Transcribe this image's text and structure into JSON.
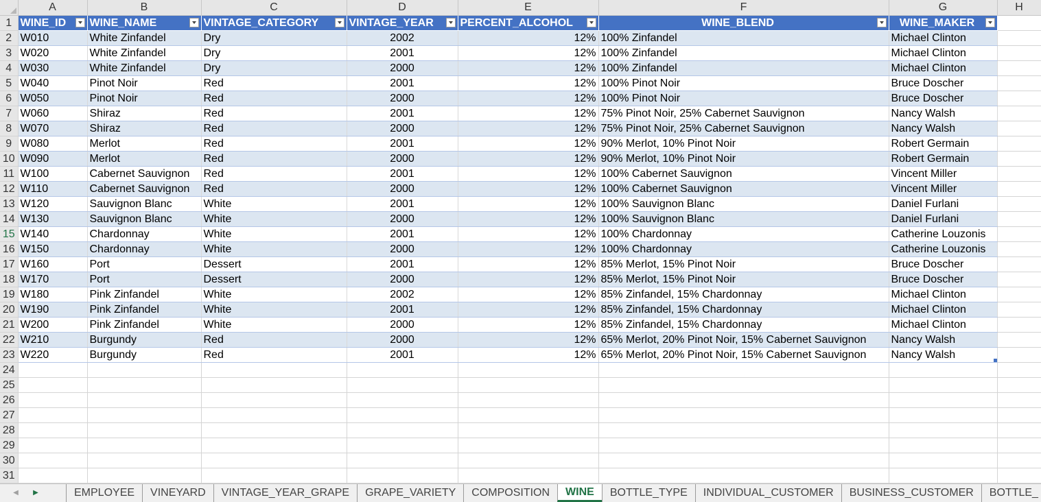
{
  "columns": [
    "A",
    "B",
    "C",
    "D",
    "E",
    "F",
    "G",
    "H"
  ],
  "headers": [
    "WINE_ID",
    "WINE_NAME",
    "VINTAGE_CATEGORY",
    "VINTAGE_YEAR",
    "PERCENT_ALCOHOL",
    "WINE_BLEND",
    "WINE_MAKER"
  ],
  "rows": [
    [
      "W010",
      "White Zinfandel",
      "Dry",
      "2002",
      "12%",
      "100% Zinfandel",
      "Michael Clinton"
    ],
    [
      "W020",
      "White Zinfandel",
      "Dry",
      "2001",
      "12%",
      "100% Zinfandel",
      "Michael Clinton"
    ],
    [
      "W030",
      "White Zinfandel",
      "Dry",
      "2000",
      "12%",
      "100% Zinfandel",
      "Michael Clinton"
    ],
    [
      "W040",
      "Pinot Noir",
      "Red",
      "2001",
      "12%",
      "100% Pinot Noir",
      "Bruce Doscher"
    ],
    [
      "W050",
      "Pinot Noir",
      "Red",
      "2000",
      "12%",
      "100% Pinot Noir",
      "Bruce Doscher"
    ],
    [
      "W060",
      "Shiraz",
      "Red",
      "2001",
      "12%",
      "75% Pinot Noir, 25% Cabernet Sauvignon",
      "Nancy Walsh"
    ],
    [
      "W070",
      "Shiraz",
      "Red",
      "2000",
      "12%",
      "75% Pinot Noir, 25% Cabernet Sauvignon",
      "Nancy Walsh"
    ],
    [
      "W080",
      "Merlot",
      "Red",
      "2001",
      "12%",
      "90% Merlot, 10% Pinot Noir",
      "Robert Germain"
    ],
    [
      "W090",
      "Merlot",
      "Red",
      "2000",
      "12%",
      "90% Merlot, 10% Pinot Noir",
      "Robert Germain"
    ],
    [
      "W100",
      "Cabernet Sauvignon",
      "Red",
      "2001",
      "12%",
      "100% Cabernet Sauvignon",
      "Vincent Miller"
    ],
    [
      "W110",
      "Cabernet Sauvignon",
      "Red",
      "2000",
      "12%",
      "100% Cabernet Sauvignon",
      "Vincent Miller"
    ],
    [
      "W120",
      "Sauvignon Blanc",
      "White",
      "2001",
      "12%",
      "100% Sauvignon Blanc",
      "Daniel Furlani"
    ],
    [
      "W130",
      "Sauvignon Blanc",
      "White",
      "2000",
      "12%",
      "100% Sauvignon Blanc",
      "Daniel Furlani"
    ],
    [
      "W140",
      "Chardonnay",
      "White",
      "2001",
      "12%",
      "100% Chardonnay",
      "Catherine Louzonis"
    ],
    [
      "W150",
      "Chardonnay",
      "White",
      "2000",
      "12%",
      "100% Chardonnay",
      "Catherine Louzonis"
    ],
    [
      "W160",
      "Port",
      "Dessert",
      "2001",
      "12%",
      "85% Merlot, 15% Pinot Noir",
      "Bruce Doscher"
    ],
    [
      "W170",
      "Port",
      "Dessert",
      "2000",
      "12%",
      "85% Merlot, 15% Pinot Noir",
      "Bruce Doscher"
    ],
    [
      "W180",
      "Pink Zinfandel",
      "White",
      "2002",
      "12%",
      "85% Zinfandel, 15% Chardonnay",
      "Michael Clinton"
    ],
    [
      "W190",
      "Pink Zinfandel",
      "White",
      "2001",
      "12%",
      "85% Zinfandel, 15% Chardonnay",
      "Michael Clinton"
    ],
    [
      "W200",
      "Pink Zinfandel",
      "White",
      "2000",
      "12%",
      "85% Zinfandel, 15% Chardonnay",
      "Michael Clinton"
    ],
    [
      "W210",
      "Burgundy",
      "Red",
      "2000",
      "12%",
      "65% Merlot, 20% Pinot Noir, 15% Cabernet Sauvignon",
      "Nancy Walsh"
    ],
    [
      "W220",
      "Burgundy",
      "Red",
      "2001",
      "12%",
      "65% Merlot, 20% Pinot Noir, 15% Cabernet Sauvignon",
      "Nancy Walsh"
    ]
  ],
  "row_numbers": [
    "1",
    "2",
    "3",
    "4",
    "5",
    "6",
    "7",
    "8",
    "9",
    "10",
    "11",
    "12",
    "13",
    "14",
    "15",
    "16",
    "17",
    "18",
    "19",
    "20",
    "21",
    "22",
    "23",
    "24",
    "25",
    "26",
    "27",
    "28",
    "29",
    "30",
    "31"
  ],
  "active_row": "15",
  "sheet_tabs": [
    "EMPLOYEE",
    "VINEYARD",
    "VINTAGE_YEAR_GRAPE",
    "GRAPE_VARIETY",
    "COMPOSITION",
    "WINE",
    "BOTTLE_TYPE",
    "INDIVIDUAL_CUSTOMER",
    "BUSINESS_CUSTOMER",
    "BOTTLE_"
  ],
  "active_tab": "WINE",
  "icons": {
    "prev": "triangle-left-icon",
    "next": "triangle-right-icon",
    "filter": "filter-dropdown-icon",
    "select_all": "select-all-triangle-icon"
  },
  "colors": {
    "header_fill": "#4472c4",
    "band_fill": "#dce6f1",
    "active_tab": "#217346"
  }
}
